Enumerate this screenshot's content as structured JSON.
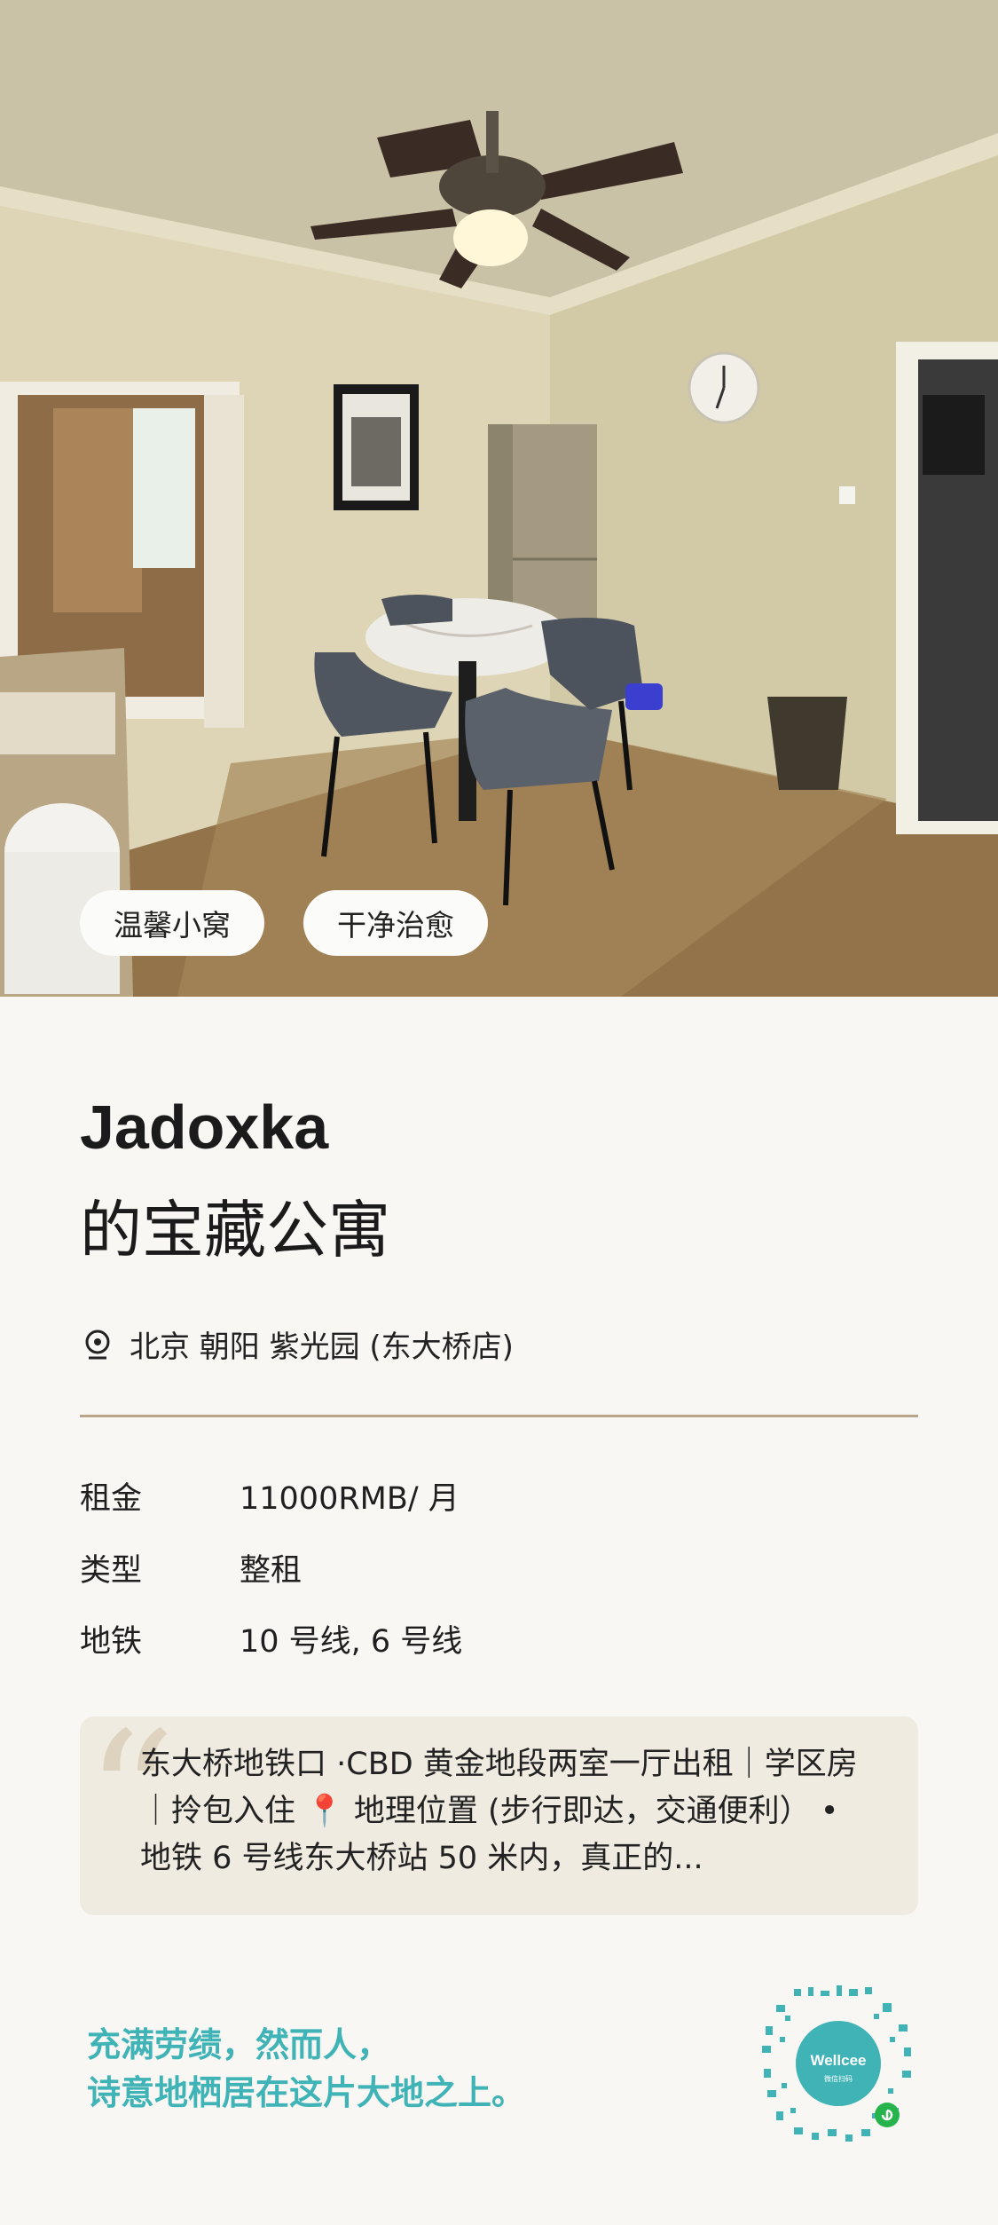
{
  "hero": {
    "tags": [
      "温馨小窝",
      "干净治愈"
    ]
  },
  "listing": {
    "owner_name": "Jadoxka",
    "title_suffix": "的宝藏公寓",
    "location": "北京 朝阳 紫光园 (东大桥店)",
    "details": [
      {
        "label": "租金",
        "value": "11000RMB/ 月"
      },
      {
        "label": "类型",
        "value": "整租"
      },
      {
        "label": "地铁",
        "value": "10 号线, 6 号线"
      }
    ],
    "description": "东大桥地铁口 ·CBD 黄金地段两室一厅出租｜学区房｜拎包入住 📍 地理位置 (步行即达，交通便利） •  地铁 6 号线东大桥站 50 米内，真正的..."
  },
  "footer": {
    "slogan_line1": "充满劳绩，然而人，",
    "slogan_line2": "诗意地栖居在这片大地之上。",
    "qr_label": "Wellcee",
    "qr_sub": "微信扫码"
  },
  "colors": {
    "accent": "#3fb3b6",
    "divider": "#b9a48c",
    "quote_bg": "#f0ebe1",
    "page_bg": "#f8f7f4"
  }
}
